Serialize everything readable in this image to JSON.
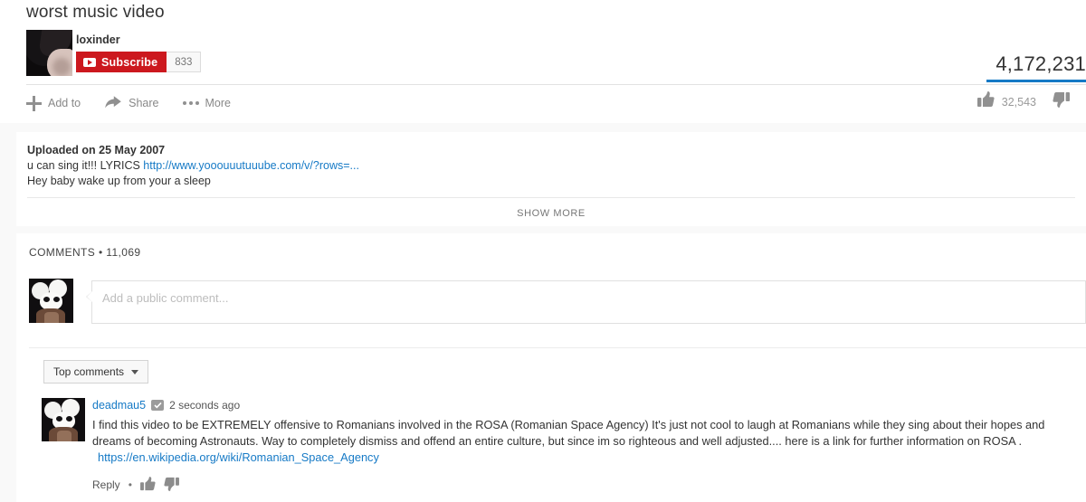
{
  "video": {
    "title": "worst music video",
    "channel_name": "loxinder",
    "subscribe_label": "Subscribe",
    "subscriber_count": "833",
    "view_count": "4,172,231",
    "likes": "32,543",
    "avatar_alt": "channel-avatar"
  },
  "actions": {
    "add_to": "Add to",
    "share": "Share",
    "more": "More"
  },
  "description": {
    "upload_date": "Uploaded on 25 May 2007",
    "line1_prefix": "u can sing it!!! LYRICS ",
    "line1_link": "http://www.yooouuutuuube.com/v/?rows=...",
    "line2": "Hey baby wake up from your a sleep",
    "show_more": "SHOW MORE"
  },
  "comments": {
    "header_label": "COMMENTS",
    "separator": "•",
    "count": "11,069",
    "input_placeholder": "Add a public comment...",
    "sort_label": "Top comments",
    "items": [
      {
        "author": "deadmau5",
        "verified": true,
        "time": "2 seconds ago",
        "text": "I find this video to be EXTREMELY offensive to Romanians involved in the ROSA (Romanian Space Agency)  It's just not cool to laugh at Romanians while they sing about their hopes and dreams of becoming Astronauts. Way to completely dismiss and offend an entire culture, but since im so righteous and well adjusted.... here is a link for further information on ROSA .",
        "link": "https://en.wikipedia.org/wiki/Romanian_Space_Agency",
        "reply_label": "Reply",
        "reply_dot": "•"
      }
    ]
  },
  "colors": {
    "brand_red": "#cc181e",
    "link_blue": "#167ac6",
    "page_bg": "#f9f9f9",
    "card_bg": "#ffffff"
  }
}
